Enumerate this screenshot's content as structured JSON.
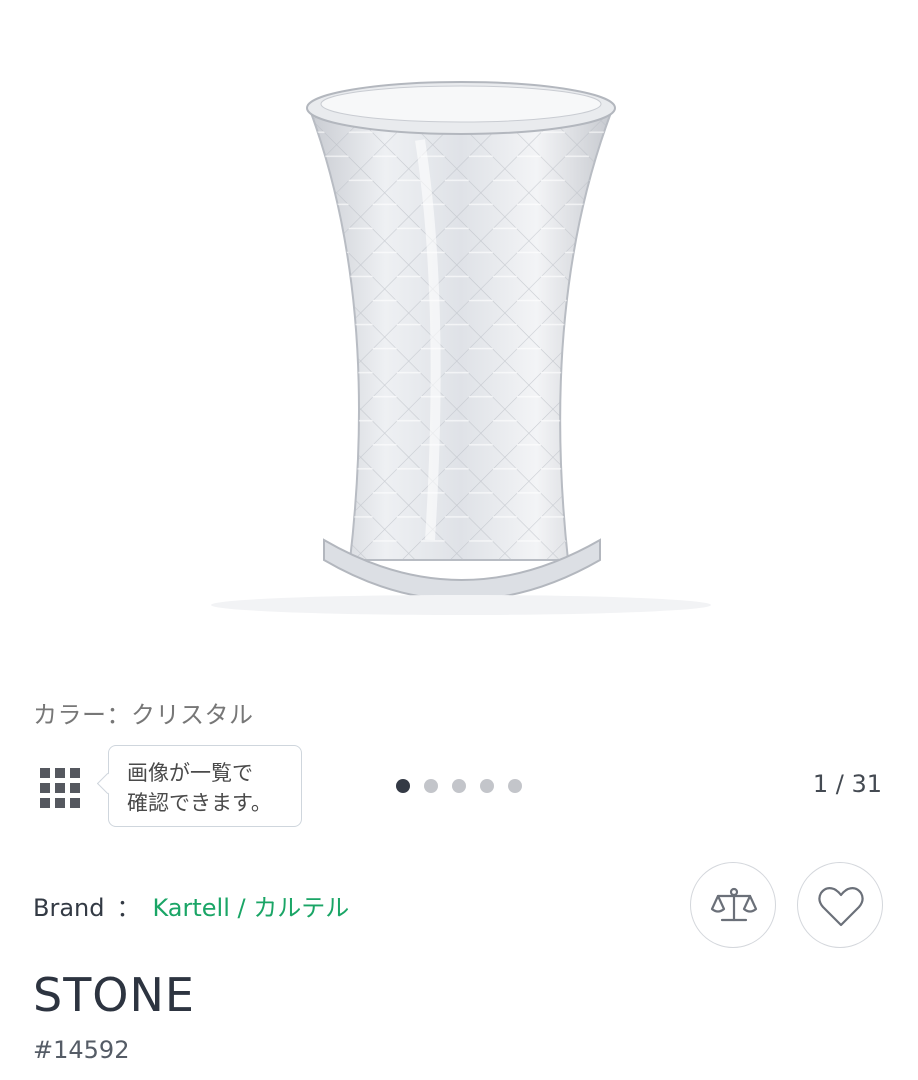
{
  "product_image": {
    "alt": ""
  },
  "color": {
    "label": "カラー：クリスタル"
  },
  "gallery": {
    "grid_icon": "grid-icon",
    "tooltip_line1": "画像が一覧で",
    "tooltip_line2": "確認できます。",
    "counter": "1 / 31",
    "dots_total": 5,
    "active_dot": 0
  },
  "brand": {
    "label": "Brand",
    "separator": "：",
    "name": "Kartell / カルテル",
    "color": "#1aa566"
  },
  "actions": {
    "compare_icon": "scale-icon",
    "favorite_icon": "heart-icon"
  },
  "product": {
    "name": "STONE",
    "sku": "#14592"
  }
}
